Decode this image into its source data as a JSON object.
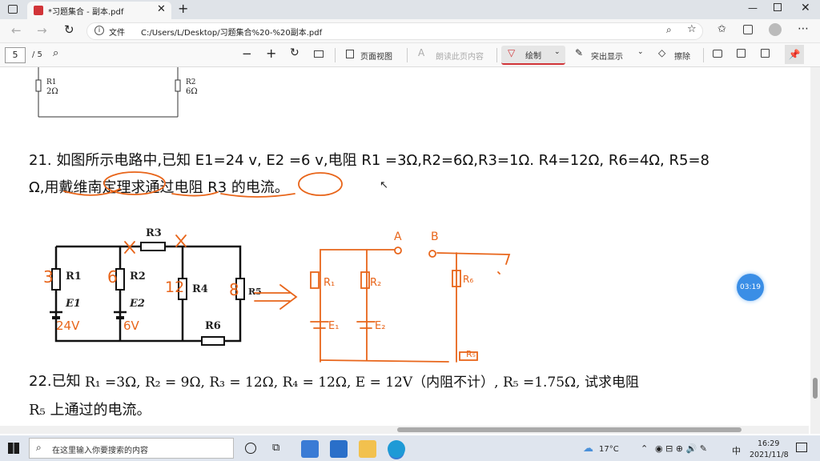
{
  "browser": {
    "tab_title": "*习题集合 - 副本.pdf",
    "file_label": "文件",
    "url": "C:/Users/L/Desktop/习题集合%20-%20副本.pdf"
  },
  "pdf_toolbar": {
    "page_current": "5",
    "page_total": "/ 5",
    "page_view": "页面视图",
    "read_aloud": "朗读此页内容",
    "draw": "绘制",
    "highlight": "突出显示",
    "erase": "擦除"
  },
  "doc": {
    "prev_r1": "R1",
    "prev_r1_val": "2Ω",
    "prev_r2": "R2",
    "prev_r2_val": "6Ω",
    "q21_line1": "21.   如图所示电路中,已知 E1=24 v, E2 =6 v,电阻 R1 =3Ω,R2=6Ω,R3=1Ω. R4=12Ω, R6=4Ω, R5=8",
    "q21_line2": "Ω,用戴维南定理求通过电阻 R3 的电流。",
    "circuit": {
      "r1": "R1",
      "r2": "R2",
      "r3": "R3",
      "r4": "R4",
      "r5": "R5",
      "r6": "R6",
      "e1": "E1",
      "e2": "E2"
    },
    "q22_line1_a": "22.已知",
    "q22_line1": " R₁ =3Ω,  R₂  = 9Ω,  R₃  = 12Ω,  R₄  = 12Ω,  E = 12V（内阻不计）,  R₅  =1.75Ω,  试求电阻",
    "q22_line2": "R₅ 上通过的电流。",
    "timer": "03:19"
  },
  "handwriting": {
    "v1": "3",
    "v2": "6",
    "v3": "12",
    "v4": "8",
    "e1v": "24V",
    "e2v": "6V",
    "a": "A",
    "b": "B",
    "r1": "R₁",
    "r2": "R₂",
    "e1": "E₁",
    "e2": "E₂",
    "r6": "R₆",
    "r5": "R₅"
  },
  "taskbar": {
    "search_placeholder": "在这里输入你要搜索的内容",
    "weather": "17°C",
    "ime": "中",
    "time": "16:29",
    "date": "2021/11/8"
  },
  "colors": {
    "ink": "#e8651a",
    "accent": "#d13438",
    "timer": "#3a8ee6"
  }
}
